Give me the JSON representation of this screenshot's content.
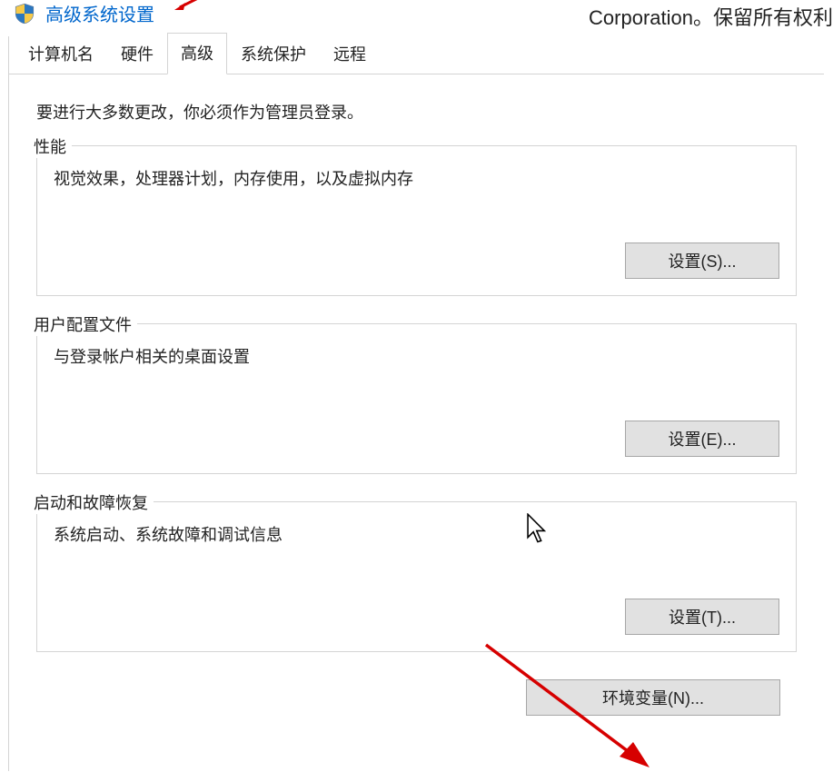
{
  "header": {
    "link_text": "高级系统设置",
    "right_text": "Corporation。保留所有权利"
  },
  "tabs": [
    {
      "label": "计算机名",
      "active": false
    },
    {
      "label": "硬件",
      "active": false
    },
    {
      "label": "高级",
      "active": true
    },
    {
      "label": "系统保护",
      "active": false
    },
    {
      "label": "远程",
      "active": false
    }
  ],
  "content": {
    "intro": "要进行大多数更改，你必须作为管理员登录。",
    "groups": [
      {
        "legend": "性能",
        "desc": "视觉效果，处理器计划，内存使用，以及虚拟内存",
        "button": "设置(S)..."
      },
      {
        "legend": "用户配置文件",
        "desc": "与登录帐户相关的桌面设置",
        "button": "设置(E)..."
      },
      {
        "legend": "启动和故障恢复",
        "desc": "系统启动、系统故障和调试信息",
        "button": "设置(T)..."
      }
    ],
    "env_button": "环境变量(N)..."
  }
}
